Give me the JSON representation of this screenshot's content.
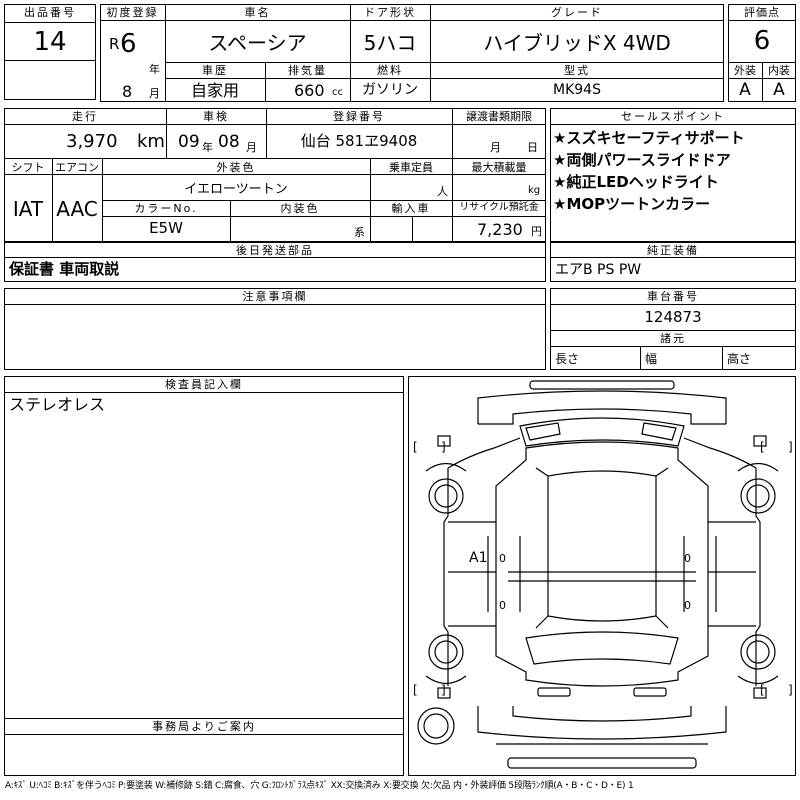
{
  "header": {
    "lot_label": "出品番号",
    "lot_no": "14",
    "first_reg_label": "初度登録",
    "era": "R",
    "year": "6",
    "year_unit": "年",
    "month": "8",
    "month_unit": "月",
    "model_label": "車名",
    "model": "スペーシア",
    "door_label": "ドア形状",
    "door": "5ハコ",
    "grade_label": "グレード",
    "grade": "ハイブリッドX 4WD",
    "score_label": "評価点",
    "score": "6",
    "history_label": "車歴",
    "history": "自家用",
    "displacement_label": "排気量",
    "displacement": "660",
    "displacement_unit": "cc",
    "fuel_label": "燃料",
    "fuel": "ガソリン",
    "type_label": "型式",
    "type": "MK94S",
    "exterior_label": "外装",
    "exterior": "A",
    "interior_label": "内装",
    "interior": "A"
  },
  "row2": {
    "mileage_label": "走行",
    "mileage": "3,970",
    "mileage_unit": "km",
    "inspection_label": "車検",
    "insp_year": "09",
    "insp_year_unit": "年",
    "insp_month": "08",
    "insp_month_unit": "月",
    "plate_label": "登録番号",
    "plate": "仙台 581ヱ9408",
    "transfer_label": "譲渡書類期限",
    "transfer_month_unit": "月",
    "transfer_day_unit": "日",
    "sales_label": "セールスポイント",
    "sales_points": [
      "★スズキセーフティサポート",
      "★両側パワースライドドア",
      "★純正LEDヘッドライト",
      "★MOPツートンカラー"
    ]
  },
  "row3": {
    "shift_label": "シフト",
    "shift": "IAT",
    "ac_label": "エアコン",
    "ac": "AAC",
    "color_label": "外装色",
    "color": "イエローツートン",
    "capacity_label": "乗車定員",
    "capacity_unit": "人",
    "load_label": "最大積載量",
    "load_unit": "kg",
    "color_no_label": "カラーNo.",
    "color_no": "E5W",
    "int_color_label": "内装色",
    "int_color_unit": "系",
    "import_label": "輸入車",
    "recycle_label": "リサイクル預託金",
    "recycle": "7,230",
    "recycle_unit": "円"
  },
  "parts": {
    "label": "後日発送部品",
    "value": "保証書 車両取説"
  },
  "equipment": {
    "label": "純正装備",
    "value": "エアB PS PW"
  },
  "notes": {
    "label": "注意事項欄"
  },
  "chassis": {
    "label": "車台番号",
    "value": "124873",
    "spec_label": "諸元",
    "length_label": "長さ",
    "width_label": "幅",
    "height_label": "高さ"
  },
  "inspector": {
    "label": "検査員記入欄",
    "value": "ステレオレス"
  },
  "office": {
    "label": "事務局よりご案内"
  },
  "diagram": {
    "mark": "A1",
    "mark_zero_1": "0",
    "mark_zero_2": "0",
    "mark_zero_3": "0",
    "mark_zero_4": "0",
    "bracket_open": "[",
    "bracket_close": "]"
  },
  "legend": "A:ｷｽﾞ U:ﾍｺﾐ B:ｷｽﾞを伴うﾍｺﾐ P:要塗装 W:補修跡 S:錆 C:腐食、穴 G:ﾌﾛﾝﾄｶﾞﾗｽ点ｷｽﾞ XX:交換済み X:要交換 欠:欠品 内・外装評価 5段階ﾗﾝｸ順(A・B・C・D・E) 1"
}
